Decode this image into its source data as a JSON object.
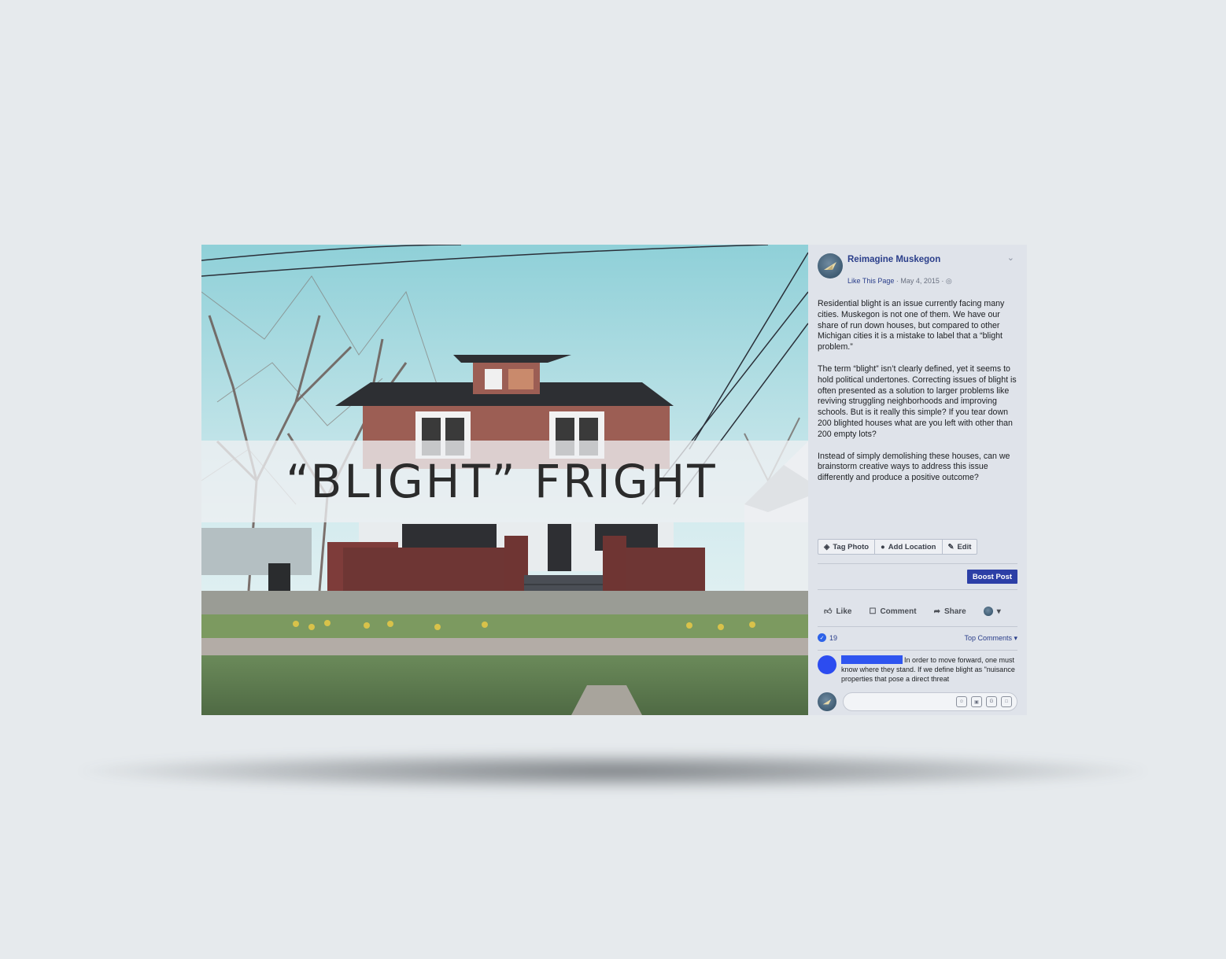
{
  "colors": {
    "background": "#e6eaed",
    "panel": "#dfe3ea",
    "brand_blue": "#2a3e8a",
    "boost_button": "#2c3fa6"
  },
  "image": {
    "banner_title": "“BLIGHT” FRIGHT"
  },
  "post": {
    "page_name": "Reimagine Muskegon",
    "like_page": "Like This Page",
    "meta": " · May 4, 2015 · ",
    "privacy_icon": "globe-icon",
    "paragraphs": [
      "Residential blight is an issue currently facing many cities. Muskegon is not one of them. We have our share of run down houses, but compared to other Michigan cities it is a mistake to label that a “blight problem.”",
      "The term “blight” isn’t clearly defined, yet it seems to hold political undertones. Correcting issues of blight is often presented as a solution to larger problems like reviving struggling neighborhoods and improving schools. But is it really this simple? If you tear down 200 blighted houses what are you left with other than 200 empty lots?",
      "Instead of simply demolishing these houses, can we brainstorm creative ways to address this issue differently and produce a positive outcome?"
    ],
    "actions": {
      "tag_photo": "Tag Photo",
      "add_location": "Add Location",
      "edit": "Edit"
    },
    "boost": "Boost Post",
    "reactions": {
      "like": "Like",
      "comment": "Comment",
      "share": "Share"
    },
    "like_count": "19",
    "top_comments": "Top Comments ▾",
    "comment_text": "In order to move forward, one must know where they stand. If we define blight as \"nuisance properties that pose a direct threat"
  }
}
